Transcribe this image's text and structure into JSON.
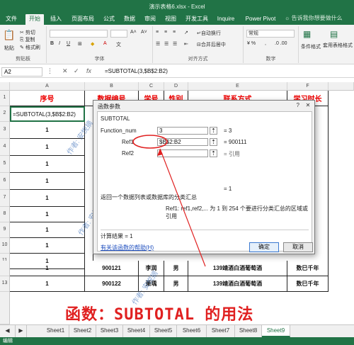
{
  "titlebar": {
    "title": "演示表格6.xlsx - Excel"
  },
  "ribbon_tabs": [
    "文件",
    "开始",
    "插入",
    "页面布局",
    "公式",
    "数据",
    "审阅",
    "视图",
    "开发工具",
    "Inquire",
    "Power Pivot"
  ],
  "tell_me": "告诉我你想要做什么",
  "ribbon": {
    "paste": "粘贴",
    "cut": "剪切",
    "copy": "复制",
    "format_painter": "格式刷",
    "clipboard": "剪贴板",
    "font_group": "字体",
    "wrap_text": "自动换行",
    "merge_center": "合并后居中",
    "alignment": "对齐方式",
    "number_format": "常规",
    "number": "数字",
    "conditional": "条件格式",
    "table_format": "套用表格格式"
  },
  "formula_bar": {
    "name_box": "A2",
    "cancel": "✕",
    "enter": "✓",
    "fx": "fx",
    "formula": "=SUBTOTAL(3,$B$2:B2)"
  },
  "columns": [
    "A",
    "B",
    "C",
    "D",
    "E",
    "F"
  ],
  "row_numbers": [
    "1",
    "2",
    "3",
    "4",
    "5",
    "6",
    "7",
    "8",
    "9",
    "10",
    "11",
    "12",
    "13"
  ],
  "header_row": [
    "序号",
    "数据编号",
    "学号",
    "性别",
    "联系方式",
    "学习时长"
  ],
  "a2_formula": "=SUBTOTAL(3,$B$2:B2)",
  "col_a_values": [
    "1",
    "1",
    "1",
    "1",
    "1",
    "1",
    "1",
    "1",
    "1",
    "1",
    "1"
  ],
  "rows_visible": [
    {
      "a": "1",
      "b": "900121",
      "c": "李润",
      "d": "男",
      "e": "139靖酒白酒葡萄酒",
      "f": "数巳千年"
    },
    {
      "a": "1",
      "b": "900122",
      "c": "萧瑀",
      "d": "男",
      "e": "139靖酒白酒葡萄酒",
      "f": "数巳千年"
    }
  ],
  "watermark": "作者: 安悦摘",
  "caption": "函数：SUBTOTAL 的用法",
  "dialog": {
    "title": "函数参数",
    "help_btn": "?",
    "close_btn": "✕",
    "function_name": "SUBTOTAL",
    "arg1_label": "Function_num",
    "arg1_value": "3",
    "arg1_result": "= 3",
    "arg2_label": "Ref1",
    "arg2_value": "$B$2:B2",
    "arg2_result": "= 900111",
    "arg3_label": "Ref2",
    "arg3_result": "= 引用",
    "result_eq": "= 1",
    "description": "返回一个数据列表或数据库的分类汇总",
    "ref_desc": "Ref1: ref1,ref2,... 为 1 到 254 个要进行分类汇总的区域或引用",
    "calc_result": "计算结果 = 1",
    "help_link": "有关该函数的帮助(H)",
    "ok": "确定",
    "cancel": "取消"
  },
  "sheets": [
    "Sheet1",
    "Sheet2",
    "Sheet3",
    "Sheet4",
    "Sheet5",
    "Sheet6",
    "Sheet7",
    "Sheet8",
    "Sheet9"
  ],
  "active_sheet": "Sheet9",
  "status": "编辑",
  "colors": {
    "excel_green": "#217346",
    "header_red": "#e00000",
    "annotation_red": "#e02020"
  }
}
